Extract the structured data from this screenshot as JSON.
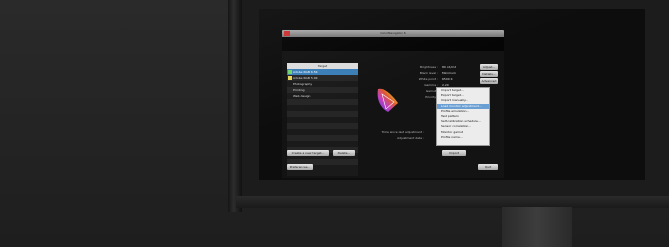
{
  "app": {
    "title": "ColorNavigator 6"
  },
  "target_list": {
    "header": "Target",
    "items": [
      {
        "label": "Adobe RGB 6.5K",
        "selected": true,
        "indicator_color": "#6fd36f"
      },
      {
        "label": "Adobe RGB 5.0K",
        "selected": false,
        "indicator_color": "#e7d35a"
      },
      {
        "label": "Photography",
        "selected": false,
        "indicator_color": ""
      },
      {
        "label": "Printing",
        "selected": false,
        "indicator_color": ""
      },
      {
        "label": "Web design",
        "selected": false,
        "indicator_color": ""
      }
    ]
  },
  "buttons": {
    "create_target": "Create a new target...",
    "delete": "Delete...",
    "preferences": "Preferences...",
    "quit": "Quit",
    "adjust": "Adjust...",
    "details": "Details...",
    "advanced": "Advanced",
    "import": "Import"
  },
  "settings": {
    "rows": [
      {
        "label": "Brightness :",
        "value": "80 cd/m2"
      },
      {
        "label": "Black level :",
        "value": "Minimum"
      },
      {
        "label": "White point :",
        "value": "6500 K"
      },
      {
        "label": "Gamma :",
        "value": "2.20"
      },
      {
        "label": "Gamut :",
        "value": ""
      },
      {
        "label": "Priority :",
        "value": ""
      }
    ],
    "time_since_adjustment_label": "Time since last adjustment :",
    "adjustment_date_label": "Adjustment date :"
  },
  "context_menu": {
    "items": [
      {
        "label": "Import target...",
        "highlighted": false
      },
      {
        "label": "Export target...",
        "highlighted": false
      },
      {
        "label": "Import manually...",
        "highlighted": false
      },
      {
        "label": "Load monitor adjustment...",
        "highlighted": true
      },
      {
        "label": "Profile emulation...",
        "highlighted": false
      },
      {
        "label": "Test pattern",
        "highlighted": false
      },
      {
        "label": "Self-calibration schedule...",
        "highlighted": false
      },
      {
        "label": "Sensor correlation...",
        "highlighted": false
      },
      {
        "label": "Monitor gamut",
        "highlighted": false
      },
      {
        "label": "Profile name...",
        "highlighted": false
      }
    ]
  },
  "colors": {
    "selection": "#3b7fb8",
    "menu_highlight": "#6a9fd4",
    "brand_logo": "#cc3333"
  }
}
